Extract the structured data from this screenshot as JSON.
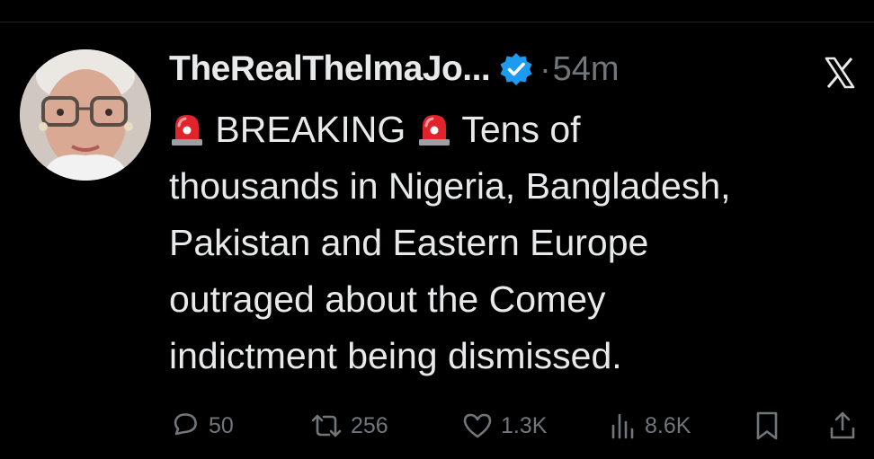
{
  "tweet": {
    "display_name": "TheRealThelmaJo...",
    "separator": "·",
    "timestamp": "54m",
    "body_lines": [
      "BREAKING",
      "Tens of",
      "thousands in Nigeria, Bangladesh,",
      "Pakistan and Eastern Europe",
      "outraged about the Comey",
      "indictment being dismissed."
    ],
    "emoji": [
      "siren-emoji",
      "siren-emoji"
    ]
  },
  "actions": {
    "replies": "50",
    "reposts": "256",
    "likes": "1.3K",
    "views": "8.6K"
  },
  "icons": [
    "verified-badge-icon",
    "x-logo-icon",
    "reply-icon",
    "repost-icon",
    "like-icon",
    "views-icon",
    "bookmark-icon",
    "share-icon"
  ],
  "colors": {
    "background": "#000000",
    "text": "#e7e9ea",
    "muted": "#71767b",
    "verified_blue": "#1d9bf0",
    "siren_red": "#e0242c"
  }
}
